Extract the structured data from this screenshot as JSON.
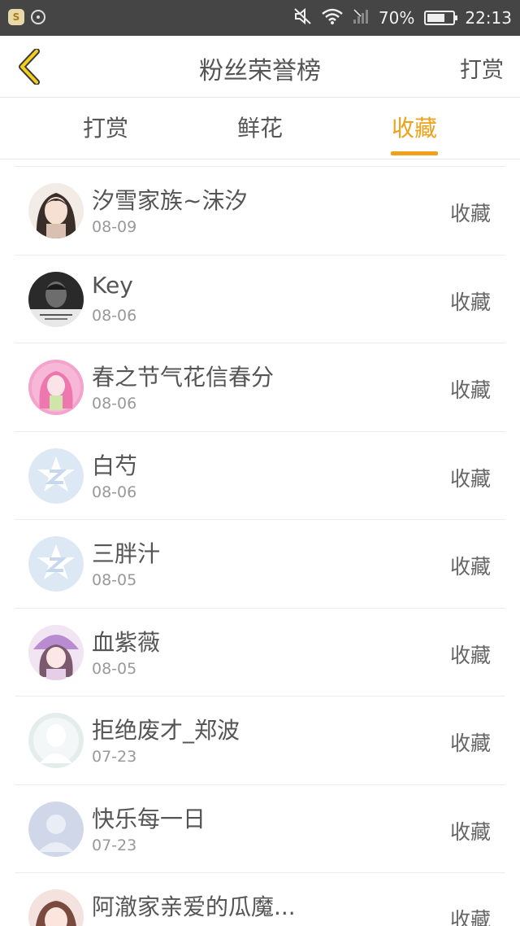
{
  "status_bar": {
    "battery": "70%",
    "time": "22:13",
    "app_badge": "S"
  },
  "nav": {
    "title": "粉丝荣誉榜",
    "action": "打赏"
  },
  "tabs": [
    {
      "label": "打赏",
      "active": false
    },
    {
      "label": "鲜花",
      "active": false
    },
    {
      "label": "收藏",
      "active": true
    }
  ],
  "colors": {
    "accent": "#f0a11a",
    "status_bar": "#454545",
    "text": "#555555",
    "muted": "#999999"
  },
  "fans": [
    {
      "name": "汐雪家族~沫汐",
      "date": "08-09",
      "action": "收藏",
      "avatar": "anime-girl-dark-hair"
    },
    {
      "name": "Key",
      "date": "08-06",
      "action": "收藏",
      "avatar": "grayscale-photo"
    },
    {
      "name": "春之节气花信春分",
      "date": "08-06",
      "action": "收藏",
      "avatar": "anime-girl-pink"
    },
    {
      "name": "白芍",
      "date": "08-06",
      "action": "收藏",
      "avatar": "qzone-default"
    },
    {
      "name": "三胖汁",
      "date": "08-05",
      "action": "收藏",
      "avatar": "qzone-default"
    },
    {
      "name": "血紫薇",
      "date": "08-05",
      "action": "收藏",
      "avatar": "anime-girl-purple"
    },
    {
      "name": "拒绝废才_郑波",
      "date": "07-23",
      "action": "收藏",
      "avatar": "default-silhouette-gray"
    },
    {
      "name": "快乐每一日",
      "date": "07-23",
      "action": "收藏",
      "avatar": "default-silhouette-blue"
    },
    {
      "name": "阿澈家亲爱的瓜魔...",
      "date": "",
      "action": "收藏",
      "avatar": "anime-girl-brown"
    }
  ]
}
